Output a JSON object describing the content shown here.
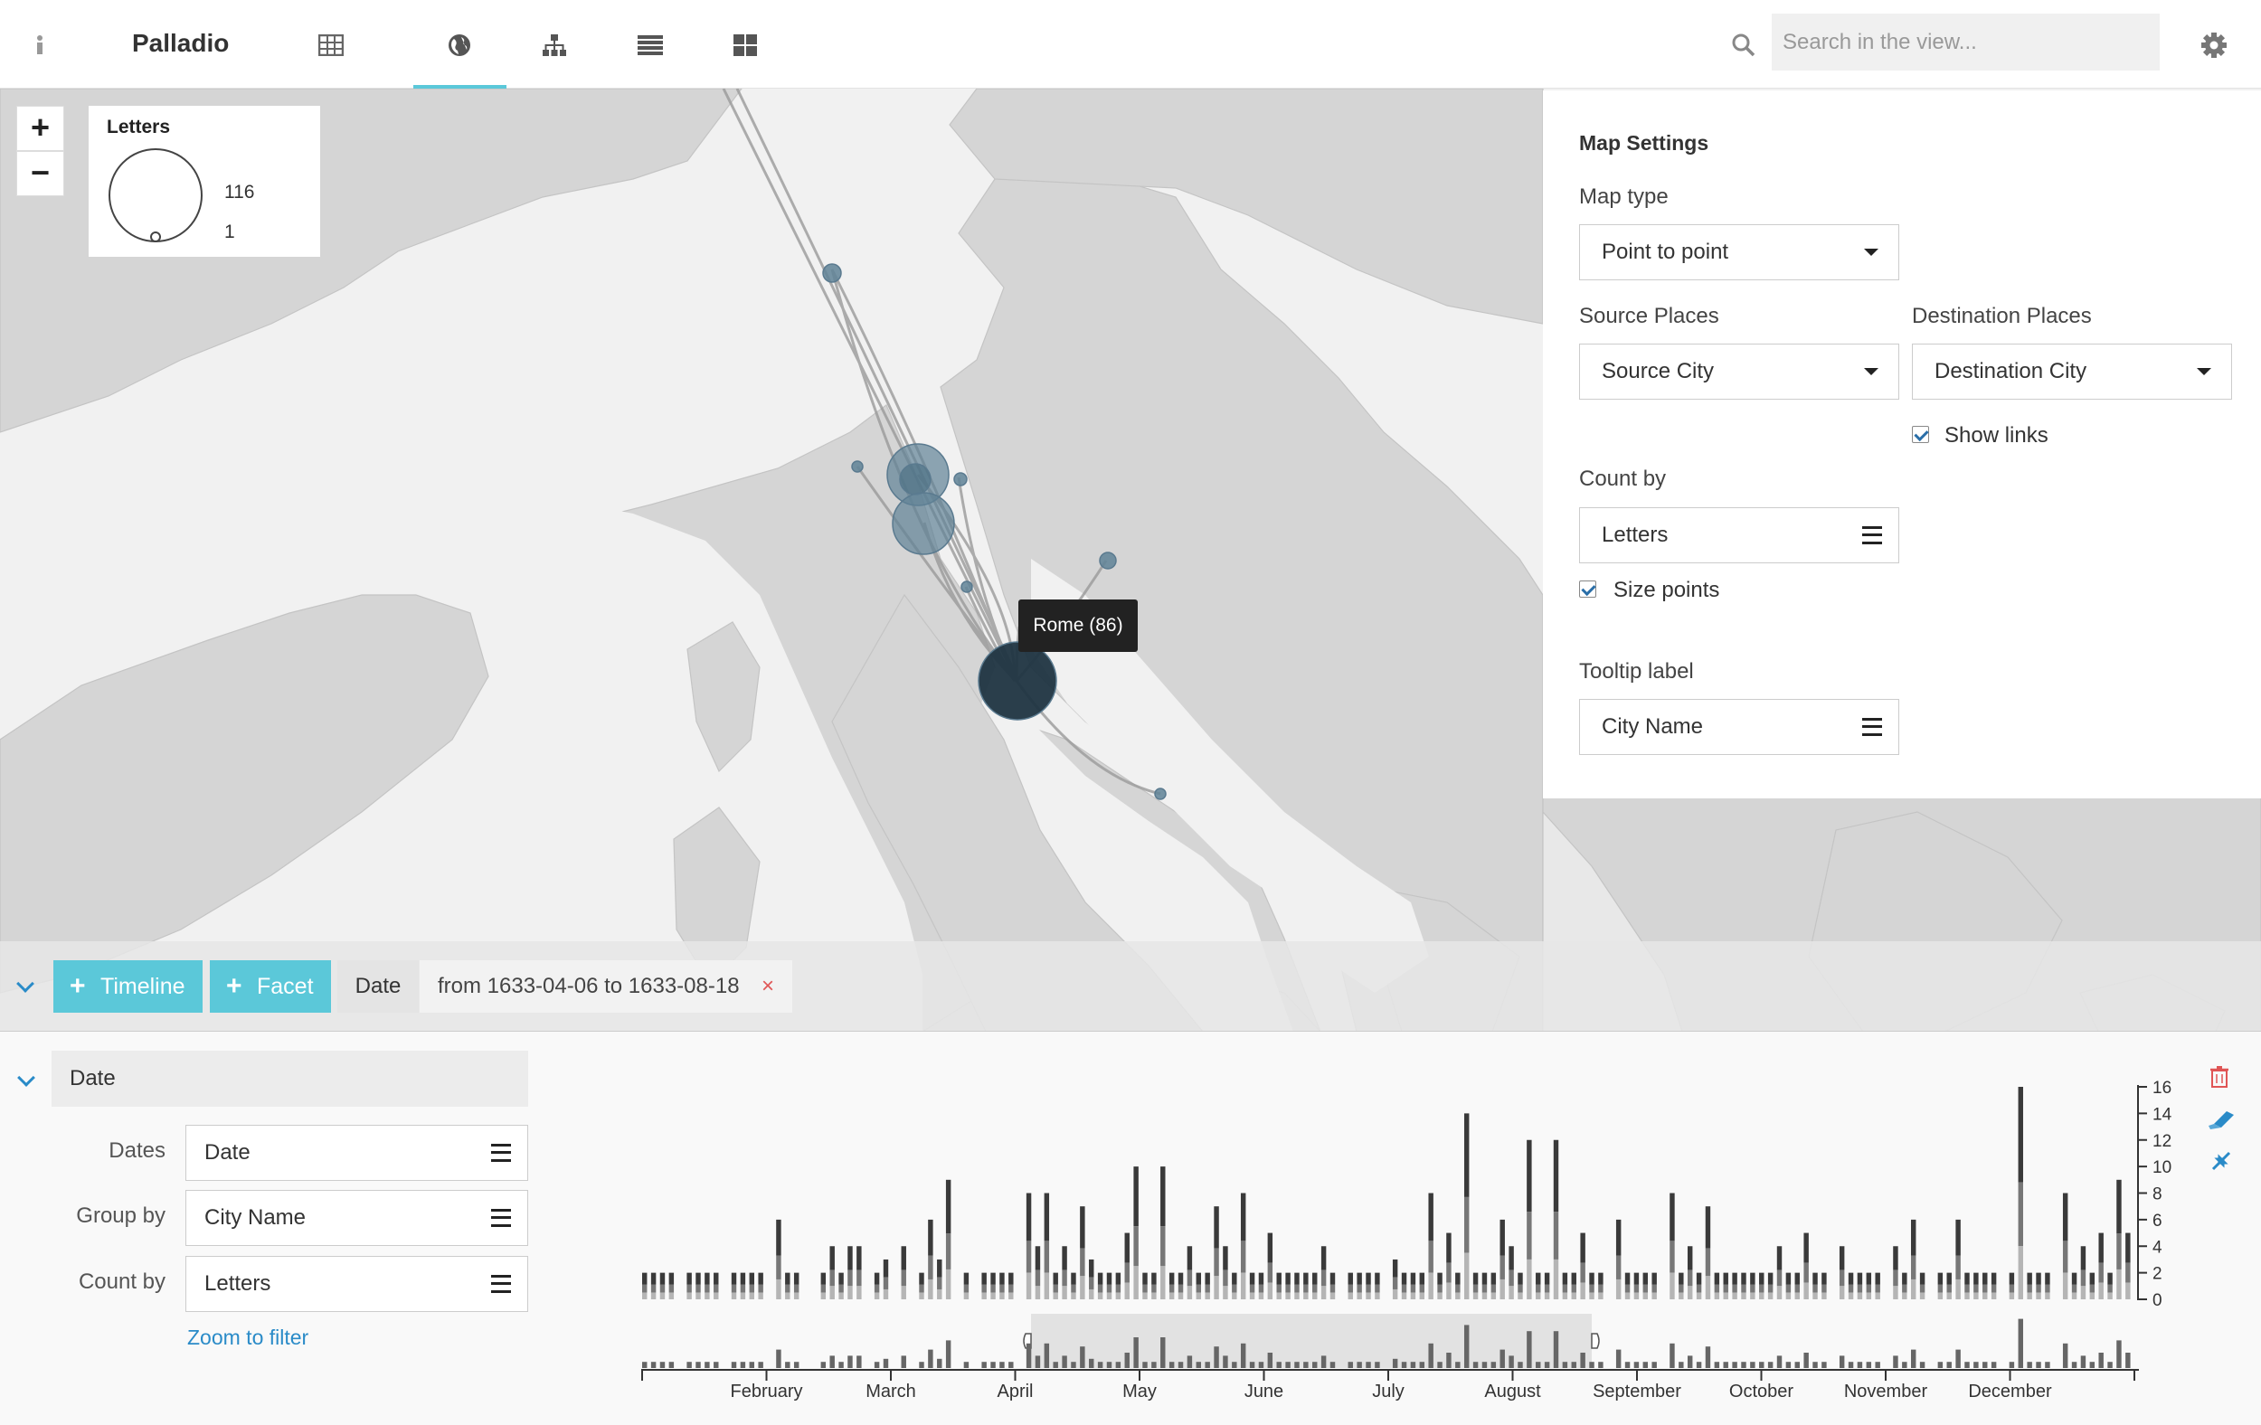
{
  "app": {
    "name": "Palladio"
  },
  "nav": {
    "icons": [
      "info-icon",
      "table-icon",
      "globe-icon",
      "graph-icon",
      "list-icon",
      "gallery-icon"
    ],
    "active": "globe-icon"
  },
  "search": {
    "placeholder": "Search in the view..."
  },
  "legend": {
    "title": "Letters",
    "max": "116",
    "min": "1"
  },
  "tooltip": {
    "text": "Rome (86)"
  },
  "settings": {
    "title": "Map Settings",
    "map_type_label": "Map type",
    "map_type_value": "Point to point",
    "source_places_label": "Source Places",
    "source_places_value": "Source City",
    "destination_places_label": "Destination Places",
    "destination_places_value": "Destination City",
    "show_links_label": "Show links",
    "show_links_checked": true,
    "count_by_label": "Count by",
    "count_by_value": "Letters",
    "size_points_label": "Size points",
    "size_points_checked": true,
    "tooltip_label": "Tooltip label",
    "tooltip_value": "City Name"
  },
  "filterbar": {
    "timeline_btn": "Timeline",
    "facet_btn": "Facet",
    "chip_key": "Date",
    "chip_value": "from 1633-04-06 to 1633-08-18",
    "chip_close": "×"
  },
  "timeline": {
    "header": "Date",
    "dates_label": "Dates",
    "dates_value": "Date",
    "group_label": "Group by",
    "group_value": "City Name",
    "count_label": "Count by",
    "count_value": "Letters",
    "zoom_to_filter": "Zoom to filter",
    "months": [
      "February",
      "March",
      "April",
      "May",
      "June",
      "July",
      "August",
      "September",
      "October",
      "November",
      "December"
    ],
    "y_ticks": [
      "0",
      "2",
      "4",
      "6",
      "8",
      "10",
      "12",
      "14",
      "16"
    ],
    "tool_icons": [
      "trash-icon",
      "eraser-icon",
      "compress-icon"
    ]
  },
  "chart_data": {
    "type": "bar",
    "title": "",
    "xlabel": "",
    "ylabel": "",
    "ylim": [
      0,
      16
    ],
    "brush": [
      "1633-04-06",
      "1633-08-18"
    ],
    "values": [
      2,
      2,
      2,
      2,
      0,
      2,
      2,
      2,
      2,
      0,
      2,
      2,
      2,
      2,
      0,
      6,
      2,
      2,
      0,
      0,
      2,
      4,
      2,
      4,
      4,
      0,
      2,
      3,
      0,
      4,
      0,
      2,
      6,
      3,
      9,
      0,
      2,
      0,
      2,
      2,
      2,
      2,
      0,
      8,
      4,
      8,
      2,
      4,
      2,
      7,
      3,
      2,
      2,
      2,
      5,
      10,
      2,
      2,
      10,
      2,
      2,
      4,
      2,
      2,
      7,
      4,
      2,
      8,
      2,
      2,
      5,
      2,
      2,
      2,
      2,
      2,
      4,
      2,
      0,
      2,
      2,
      2,
      2,
      0,
      3,
      2,
      2,
      2,
      8,
      2,
      5,
      2,
      14,
      2,
      2,
      2,
      6,
      4,
      2,
      12,
      2,
      2,
      12,
      2,
      2,
      5,
      2,
      2,
      0,
      6,
      2,
      2,
      2,
      2,
      0,
      8,
      2,
      4,
      2,
      7,
      2,
      2,
      2,
      2,
      2,
      2,
      2,
      4,
      2,
      2,
      5,
      2,
      2,
      0,
      4,
      2,
      2,
      2,
      2,
      0,
      4,
      2,
      6,
      2,
      0,
      2,
      2,
      6,
      2,
      2,
      2,
      2,
      0,
      2,
      16,
      2,
      2,
      2,
      0,
      8,
      2,
      4,
      2,
      5,
      2,
      9,
      5
    ]
  }
}
